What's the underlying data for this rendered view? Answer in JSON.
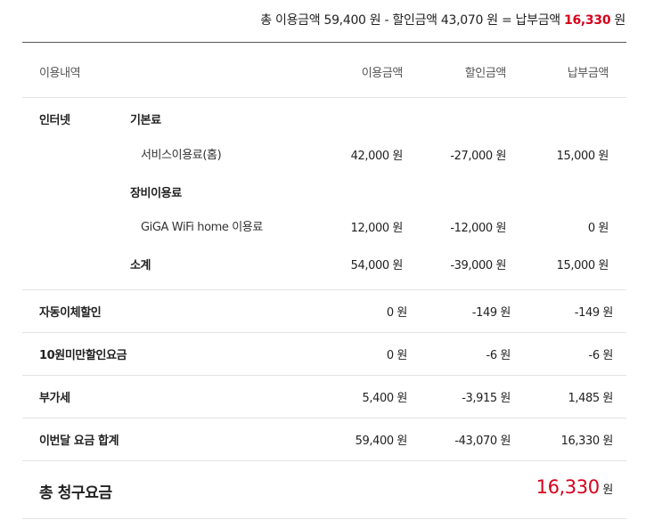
{
  "summary": {
    "prefix": "총 이용금액 59,400 원 - 할인금액 43,070 원 = 납부금액 ",
    "highlight": "16,330",
    "suffix": " 원"
  },
  "columns": {
    "detail": "이용내역",
    "usage": "이용금액",
    "discount": "할인금액",
    "payment": "납부금액"
  },
  "internet": {
    "category": "인터넷",
    "base_fee": {
      "label": "기본료",
      "item": {
        "name": "서비스이용료(홈)",
        "usage": "42,000 원",
        "discount": "-27,000 원",
        "payment": "15,000 원"
      }
    },
    "equipment_fee": {
      "label": "장비이용료",
      "item": {
        "name": "GiGA WiFi home 이용료",
        "usage": "12,000 원",
        "discount": "-12,000 원",
        "payment": "0 원"
      }
    },
    "subtotal": {
      "label": "소계",
      "usage": "54,000 원",
      "discount": "-39,000 원",
      "payment": "15,000 원"
    }
  },
  "rows": [
    {
      "label": "자동이체할인",
      "usage": "0 원",
      "discount": "-149 원",
      "payment": "-149 원"
    },
    {
      "label": "10원미만할인요금",
      "usage": "0 원",
      "discount": "-6 원",
      "payment": "-6 원"
    },
    {
      "label": "부가세",
      "usage": "5,400 원",
      "discount": "-3,915 원",
      "payment": "1,485 원"
    },
    {
      "label": "이번달 요금 합계",
      "usage": "59,400 원",
      "discount": "-43,070 원",
      "payment": "16,330 원"
    }
  ],
  "total": {
    "label": "총 청구요금",
    "amount": "16,330",
    "unit": " 원"
  },
  "colors": {
    "accent": "#d6001c",
    "text": "#222222",
    "divider": "#e3e3e3",
    "rule": "#555555"
  }
}
